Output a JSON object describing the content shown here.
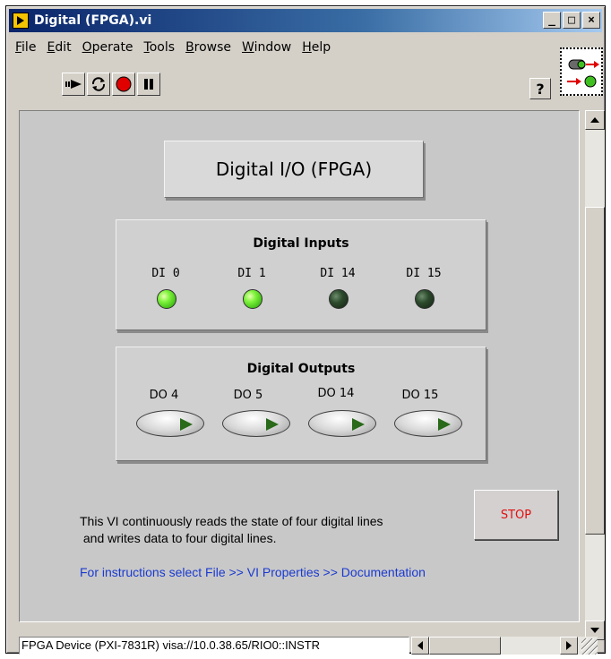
{
  "window": {
    "title": "Digital (FPGA).vi"
  },
  "title_buttons": [
    "_",
    "□",
    "×"
  ],
  "menu": [
    "File",
    "Edit",
    "Operate",
    "Tools",
    "Browse",
    "Window",
    "Help"
  ],
  "toolbar": {
    "buttons": [
      "run-arrow-icon",
      "run-continuously-icon",
      "abort-icon",
      "pause-icon"
    ],
    "help_label": "?"
  },
  "panel": {
    "title": "Digital I/O (FPGA)",
    "inputs": {
      "title": "Digital Inputs",
      "items": [
        {
          "label": "DI 0",
          "state": "on"
        },
        {
          "label": "DI 1",
          "state": "on"
        },
        {
          "label": "DI 14",
          "state": "off"
        },
        {
          "label": "DI 15",
          "state": "off"
        }
      ]
    },
    "outputs": {
      "title": "Digital Outputs",
      "items": [
        {
          "label": "DO 4"
        },
        {
          "label": "DO 5"
        },
        {
          "label": "DO 14"
        },
        {
          "label": "DO 15"
        }
      ]
    },
    "description": "This VI continuously reads the state of four digital lines\n and writes data to four digital lines.",
    "stop_label": "STOP",
    "instructions": "For instructions select File >> VI Properties >> Documentation"
  },
  "status": {
    "target": "FPGA Device (PXI-7831R) visa://10.0.38.65/RIO0::INSTR"
  },
  "colors": {
    "title_bar": "#0a246a",
    "led_on": "#7cf23a",
    "led_off": "#2c4a2c",
    "stop_text": "#e01010",
    "link": "#1a3ad0"
  }
}
